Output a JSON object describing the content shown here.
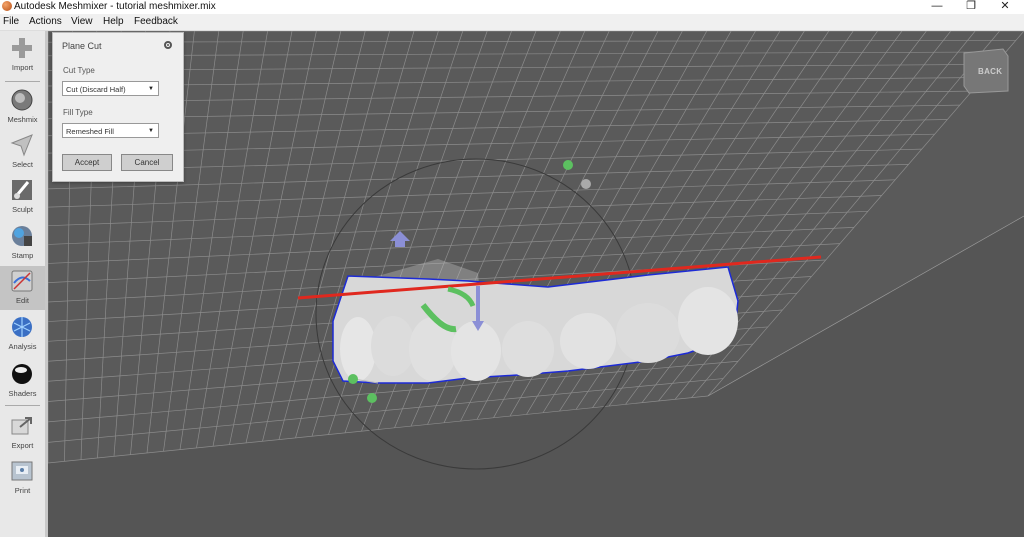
{
  "window": {
    "title": "Autodesk Meshmixer - tutorial meshmixer.mix",
    "controls": {
      "minimize": "—",
      "restore": "❐",
      "close": "✕"
    }
  },
  "menu": {
    "items": [
      "File",
      "Actions",
      "View",
      "Help",
      "Feedback"
    ]
  },
  "sidebar": {
    "tools": [
      {
        "label": "Import",
        "icon": "plus-icon"
      },
      {
        "label": "Meshmix",
        "icon": "meshmix-icon"
      },
      {
        "label": "Select",
        "icon": "select-arrow-icon"
      },
      {
        "label": "Sculpt",
        "icon": "brush-icon"
      },
      {
        "label": "Stamp",
        "icon": "stamp-icon"
      },
      {
        "label": "Edit",
        "icon": "edit-icon",
        "active": true
      },
      {
        "label": "Analysis",
        "icon": "analysis-icon"
      },
      {
        "label": "Shaders",
        "icon": "shaders-icon"
      },
      {
        "label": "Export",
        "icon": "export-icon"
      },
      {
        "label": "Print",
        "icon": "print-icon"
      }
    ]
  },
  "panel": {
    "title": "Plane Cut",
    "gear_icon": "gear-icon",
    "cut_type": {
      "label": "Cut Type",
      "value": "Cut (Discard Half)"
    },
    "fill_type": {
      "label": "Fill Type",
      "value": "Remeshed Fill"
    },
    "accept_label": "Accept",
    "cancel_label": "Cancel"
  },
  "viewcube": {
    "label": "BACK"
  },
  "colors": {
    "viewport_bg": "#555555",
    "grid": "#9a9a9a",
    "cut_plane_line": "#e0281e",
    "gizmo_green": "#5cc060",
    "gizmo_blue": "#8b8fd6",
    "mesh_outline": "#1d2bd6"
  }
}
